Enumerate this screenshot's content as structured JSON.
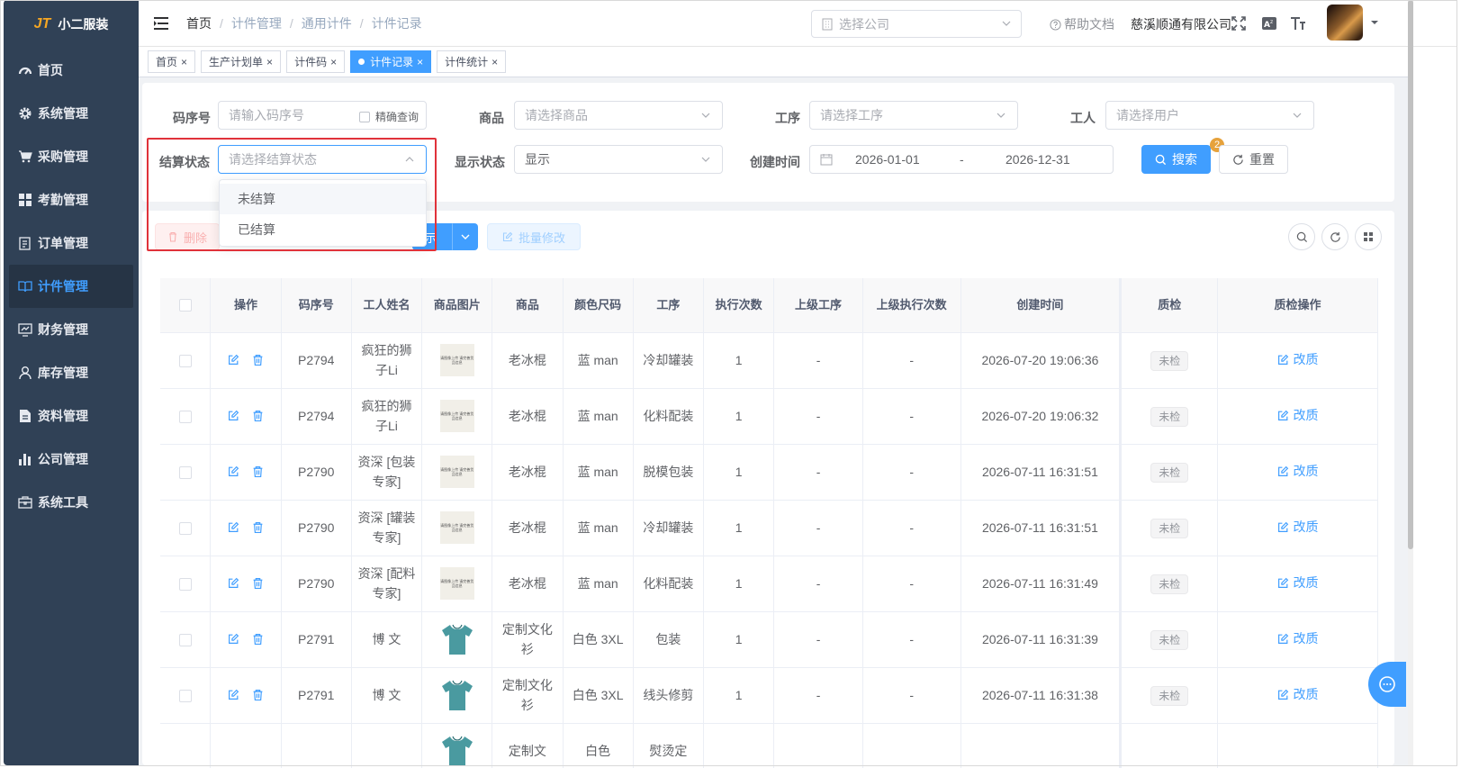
{
  "app": {
    "logo_mark": "JT",
    "name": "小二服装"
  },
  "sidebar": {
    "items": [
      {
        "label": "首页",
        "icon": "dashboard-icon"
      },
      {
        "label": "系统管理",
        "icon": "gear-icon"
      },
      {
        "label": "采购管理",
        "icon": "cart-icon"
      },
      {
        "label": "考勤管理",
        "icon": "grid-icon"
      },
      {
        "label": "订单管理",
        "icon": "clipboard-icon"
      },
      {
        "label": "计件管理",
        "icon": "book-icon"
      },
      {
        "label": "财务管理",
        "icon": "chart-monitor-icon"
      },
      {
        "label": "库存管理",
        "icon": "user-icon"
      },
      {
        "label": "资料管理",
        "icon": "document-icon"
      },
      {
        "label": "公司管理",
        "icon": "bar-chart-icon"
      },
      {
        "label": "系统工具",
        "icon": "toolbox-icon"
      }
    ],
    "active_index": 5
  },
  "header": {
    "breadcrumb": [
      "首页",
      "计件管理",
      "通用计件",
      "计件记录"
    ],
    "company_placeholder": "选择公司",
    "help_label": "帮助文档",
    "company_name": "慈溪顺通有限公司"
  },
  "tags": [
    {
      "label": "首页",
      "active": false
    },
    {
      "label": "生产计划单",
      "active": false
    },
    {
      "label": "计件码",
      "active": false
    },
    {
      "label": "计件记录",
      "active": true
    },
    {
      "label": "计件统计",
      "active": false
    }
  ],
  "search": {
    "code_label": "码序号",
    "code_placeholder": "请输入码序号",
    "exact_label": "精确查询",
    "product_label": "商品",
    "product_placeholder": "请选择商品",
    "process_label": "工序",
    "process_placeholder": "请选择工序",
    "worker_label": "工人",
    "worker_placeholder": "请选择用户",
    "settle_label": "结算状态",
    "settle_placeholder": "请选择结算状态",
    "display_label": "显示状态",
    "display_value": "显示",
    "created_label": "创建时间",
    "date_start": "2026-01-01",
    "date_sep": "-",
    "date_end": "2026-12-31",
    "search_button": "搜索",
    "search_badge": "2",
    "reset_button": "重置"
  },
  "settle_dropdown": {
    "options": [
      "未结算",
      "已结算"
    ]
  },
  "toolbar": {
    "delete_label": "删除",
    "show_label_partial": "示",
    "batch_edit_label": "批量修改"
  },
  "table": {
    "columns": [
      "操作",
      "码序号",
      "工人姓名",
      "商品图片",
      "商品",
      "颜色尺码",
      "工序",
      "执行次数",
      "上级工序",
      "上级执行次数",
      "创建时间",
      "质检",
      "质检操作"
    ],
    "image_placeholder_text": "请图像上传 请完善货品信息",
    "rows": [
      {
        "code": "P2794",
        "worker": "疯狂的狮子Li",
        "image": "placeholder",
        "product": "老冰棍",
        "color_size": "蓝 man",
        "process": "冷却罐装",
        "count": "1",
        "parent_process": "-",
        "parent_count": "-",
        "created": "2026-07-20 19:06:36",
        "qc": "未检",
        "qc_action": "改质"
      },
      {
        "code": "P2794",
        "worker": "疯狂的狮子Li",
        "image": "placeholder",
        "product": "老冰棍",
        "color_size": "蓝 man",
        "process": "化料配装",
        "count": "1",
        "parent_process": "-",
        "parent_count": "-",
        "created": "2026-07-20 19:06:32",
        "qc": "未检",
        "qc_action": "改质"
      },
      {
        "code": "P2790",
        "worker": "资深 [包装专家]",
        "image": "placeholder",
        "product": "老冰棍",
        "color_size": "蓝 man",
        "process": "脱模包装",
        "count": "1",
        "parent_process": "-",
        "parent_count": "-",
        "created": "2026-07-11 16:31:51",
        "qc": "未检",
        "qc_action": "改质"
      },
      {
        "code": "P2790",
        "worker": "资深 [罐装专家]",
        "image": "placeholder",
        "product": "老冰棍",
        "color_size": "蓝 man",
        "process": "冷却罐装",
        "count": "1",
        "parent_process": "-",
        "parent_count": "-",
        "created": "2026-07-11 16:31:51",
        "qc": "未检",
        "qc_action": "改质"
      },
      {
        "code": "P2790",
        "worker": "资深 [配料专家]",
        "image": "placeholder",
        "product": "老冰棍",
        "color_size": "蓝 man",
        "process": "化料配装",
        "count": "1",
        "parent_process": "-",
        "parent_count": "-",
        "created": "2026-07-11 16:31:49",
        "qc": "未检",
        "qc_action": "改质"
      },
      {
        "code": "P2791",
        "worker": "博 文",
        "image": "tshirt",
        "product": "定制文化衫",
        "color_size": "白色 3XL",
        "process": "包装",
        "count": "1",
        "parent_process": "-",
        "parent_count": "-",
        "created": "2026-07-11 16:31:39",
        "qc": "未检",
        "qc_action": "改质"
      },
      {
        "code": "P2791",
        "worker": "博 文",
        "image": "tshirt",
        "product": "定制文化衫",
        "color_size": "白色 3XL",
        "process": "线头修剪",
        "count": "1",
        "parent_process": "-",
        "parent_count": "-",
        "created": "2026-07-11 16:31:38",
        "qc": "未检",
        "qc_action": "改质"
      },
      {
        "code": "",
        "worker": "",
        "image": "tshirt",
        "product": "定制文",
        "color_size": "白色",
        "process": "熨烫定",
        "count": "",
        "parent_process": "",
        "parent_count": "",
        "created": "",
        "qc": "",
        "qc_action": ""
      }
    ]
  },
  "colors": {
    "sidebar_bg": "#304156",
    "primary": "#409eff",
    "highlight_border": "#e0323a",
    "badge": "#e6a23c"
  }
}
